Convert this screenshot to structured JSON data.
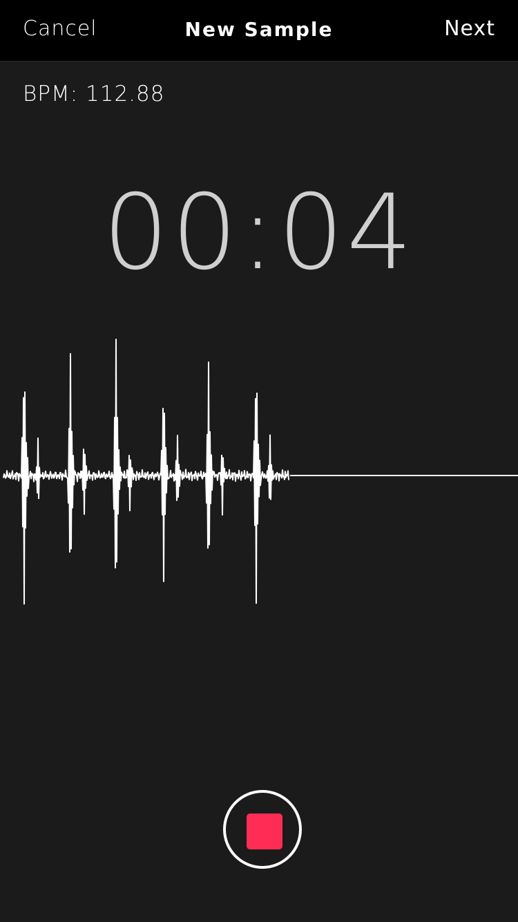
{
  "nav": {
    "cancel_label": "Cancel",
    "title": "New Sample",
    "next_label": "Next"
  },
  "bpm_text": "BPM: 112.88",
  "timer_text": "00:04",
  "waveform": {
    "beat_count": 6,
    "progress": 0.56
  },
  "colors": {
    "nav_background": "#000000",
    "screen_background": "#1b1b1b",
    "timer_text": "#cfcfcf",
    "waveform": "#ffffff",
    "stop_accent": "#ff2d55"
  },
  "icons": {
    "record_control": "stop-icon"
  }
}
